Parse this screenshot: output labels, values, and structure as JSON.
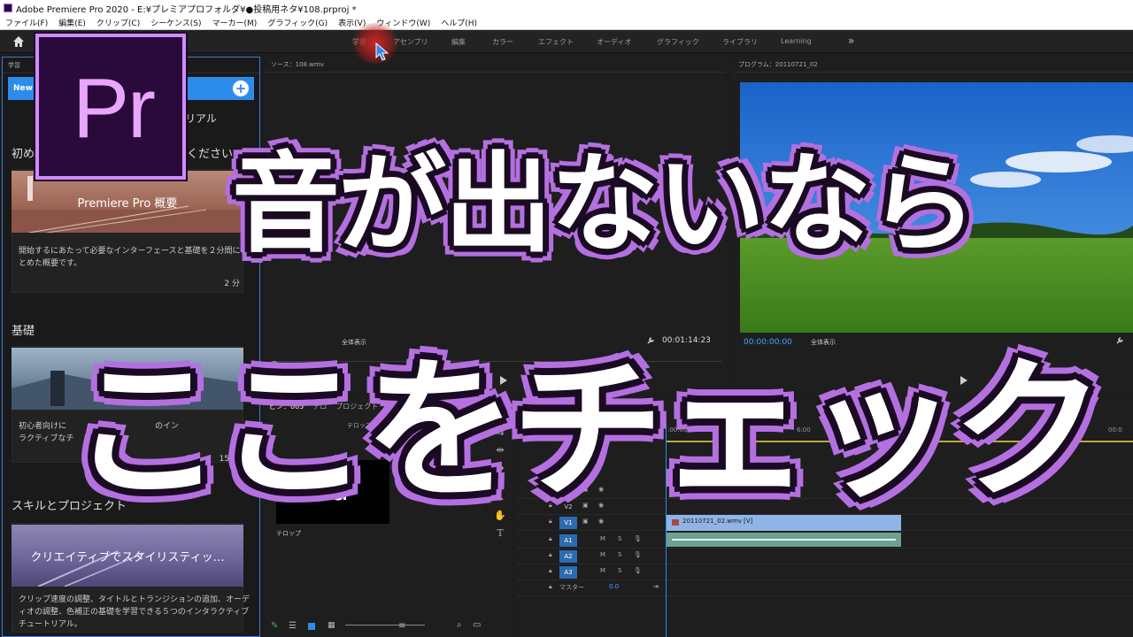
{
  "window": {
    "title": "Adobe Premiere Pro 2020 - E:¥プレミアプロフォルダ¥●投稿用ネタ¥108.prproj *"
  },
  "menubar": {
    "items": [
      "ファイル(F)",
      "編集(E)",
      "クリップ(C)",
      "シーケンス(S)",
      "マーカー(M)",
      "グラフィック(G)",
      "表示(V)",
      "ウィンドウ(W)",
      "ヘルプ(H)"
    ]
  },
  "workspaces": {
    "tabs": [
      "学習",
      "アセンブリ",
      "編集",
      "カラー",
      "エフェクト",
      "オーディオ",
      "グラフィック",
      "ライブラリ",
      "Learning"
    ],
    "more": "»"
  },
  "learn_panel": {
    "header": "学習",
    "new_to": "New t",
    "subtitle": "リアル",
    "section1": "初め",
    "section1_suffix": "ください",
    "card1": {
      "image_label": "Premiere Pro 概要",
      "desc": "開始するにあたって必要なインターフェースと基礎を２分間にまとめた概要です。",
      "duration": "2 分"
    },
    "section2": "基礎",
    "card2": {
      "image_label": "基礎を学習",
      "desc_a": "初心者向けに",
      "desc_b": "のイン",
      "desc_c": "ラクティブなチ",
      "duration": "15 分"
    },
    "section3": "スキルとプロジェクト",
    "card3": {
      "image_label": "クリエイティブでスタイリスティッ…",
      "desc": "クリップ速度の調整、タイトルとトランジションの追加、オーディオの調整、色補正の基礎を学習できる５つのインタラクティブチュートリアル。"
    }
  },
  "source_panel": {
    "header": "ソース：108.wmv",
    "zoom": "全体表示",
    "timecode": "00:01:14:23"
  },
  "program_panel": {
    "header": "プログラム：20110721_02",
    "timecode": "00:00:00:00",
    "zoom": "全体表示"
  },
  "project_panel": {
    "tabs": [
      "ビン：003",
      "テロ",
      "プロジェクト"
    ],
    "tab_suffix": "テロップ",
    "thumb_text": "Aa",
    "item_name": "テロップ"
  },
  "timeline": {
    "timecode": "00:00:",
    "ruler": [
      ":00:00",
      "6:00",
      "00:00:24",
      ":00",
      "00:00:40:00",
      "00:0"
    ],
    "video_tracks": [
      "V3",
      "V2",
      "V1"
    ],
    "audio_tracks": [
      "A1",
      "A2",
      "A3"
    ],
    "master": "マスター",
    "master_value": "0.0",
    "clip_label": "20110721_02.wmv [V]"
  },
  "overlay": {
    "line1": "音が出ないなら",
    "line2": "ここをチェック"
  },
  "logo": {
    "text": "Pr"
  },
  "colors": {
    "accent_blue": "#2d8ceb",
    "overlay_outline": "#b470e0",
    "logo_bg": "#2a0a3a",
    "logo_fg": "#e9a6ff"
  }
}
